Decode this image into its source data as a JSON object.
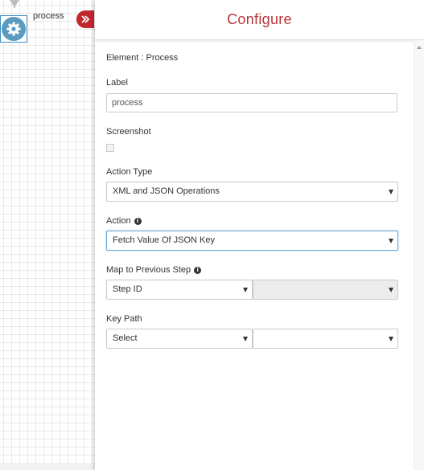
{
  "canvas": {
    "node_label": "process",
    "node_icon": "gear-icon",
    "collapse_icon": "double-chevron-right-icon"
  },
  "panel": {
    "title": "Configure",
    "element_line": "Element : Process",
    "label": {
      "label": "Label",
      "value": "process"
    },
    "screenshot": {
      "label": "Screenshot",
      "checked": false
    },
    "action_type": {
      "label": "Action Type",
      "value": "XML and JSON Operations"
    },
    "action": {
      "label": "Action",
      "value": "Fetch Value Of JSON Key",
      "info_icon": "info-icon"
    },
    "map_prev": {
      "label": "Map to Previous Step",
      "value": "Step ID",
      "second_value": ""
    },
    "key_path": {
      "label": "Key Path",
      "value": "Select",
      "second_value": ""
    }
  },
  "colors": {
    "title": "#b8353a",
    "collapse_button": "#c1272d",
    "node": "#5b9bc0",
    "focus_border": "#6aa8d8"
  }
}
